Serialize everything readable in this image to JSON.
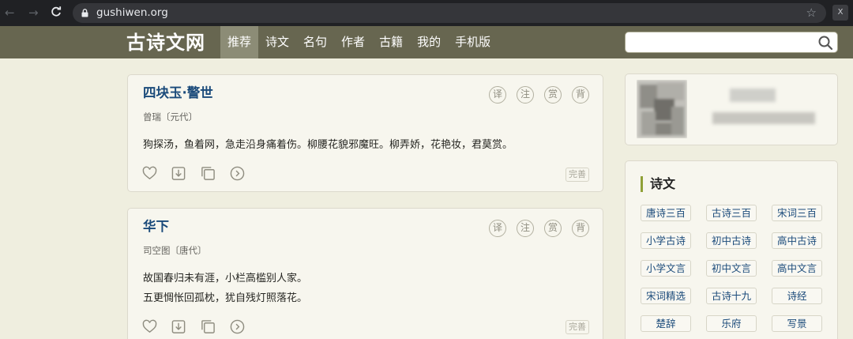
{
  "browser": {
    "back_icon": "←",
    "forward_icon": "→",
    "reload_icon": "C",
    "url": "gushiwen.org",
    "bookmark_icon": "☆",
    "extension_label": "X"
  },
  "site": {
    "logo": "古诗文网",
    "nav": [
      "推荐",
      "诗文",
      "名句",
      "作者",
      "古籍",
      "我的",
      "手机版"
    ],
    "active_nav": "推荐",
    "search_placeholder": ""
  },
  "poems": [
    {
      "title": "四块玉·警世",
      "author": "曾瑞〔元代〕",
      "lines": [
        "狗探汤，鱼着网，急走沿身痛着伤。柳腰花貌邪魔旺。柳弄娇，花艳妆，君莫赏。"
      ],
      "actions": [
        "译",
        "注",
        "赏",
        "背"
      ],
      "badge": "完善"
    },
    {
      "title": "华下",
      "author": "司空图〔唐代〕",
      "lines": [
        "故国春归未有涯，小栏高槛别人家。",
        "五更惆怅回孤枕，犹自残灯照落花。"
      ],
      "actions": [
        "译",
        "注",
        "赏",
        "背"
      ],
      "badge": "完善"
    }
  ],
  "sidebar": {
    "category_title": "诗文",
    "categories": [
      "唐诗三百",
      "古诗三百",
      "宋词三百",
      "小学古诗",
      "初中古诗",
      "高中古诗",
      "小学文言",
      "初中文言",
      "高中文言",
      "宋词精选",
      "古诗十九",
      "诗经",
      "楚辞",
      "乐府",
      "写景"
    ]
  },
  "colors": {
    "header_bg": "#676650",
    "active_tab": "#8c8c76",
    "page_bg": "#efeedf",
    "title_link": "#1a4a7a",
    "accent_bar": "#8fa036"
  },
  "icons": {
    "tools": [
      "heart-icon",
      "download-icon",
      "copy-icon",
      "play-icon"
    ],
    "search": "search-icon",
    "lock": "lock-icon"
  }
}
